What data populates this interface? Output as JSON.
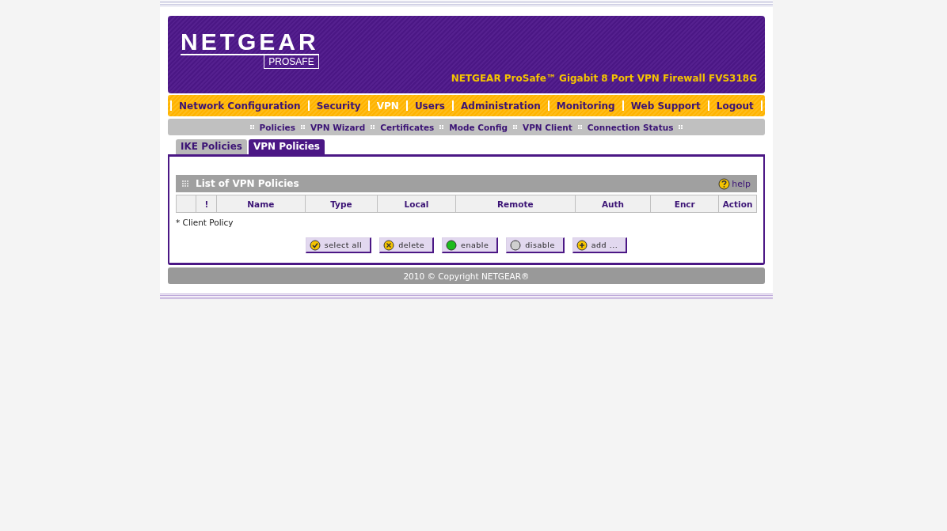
{
  "header": {
    "logo": "NETGEAR",
    "logo_sub": "PROSAFE",
    "product": "NETGEAR ProSafe™ Gigabit 8 Port VPN Firewall FVS318G"
  },
  "nav": [
    {
      "label": "Network Configuration",
      "selected": false
    },
    {
      "label": "Security",
      "selected": false
    },
    {
      "label": "VPN",
      "selected": true
    },
    {
      "label": "Users",
      "selected": false
    },
    {
      "label": "Administration",
      "selected": false
    },
    {
      "label": "Monitoring",
      "selected": false
    },
    {
      "label": "Web Support",
      "selected": false
    },
    {
      "label": "Logout",
      "selected": false
    }
  ],
  "subnav": [
    "Policies",
    "VPN Wizard",
    "Certificates",
    "Mode Config",
    "VPN Client",
    "Connection Status"
  ],
  "tabs": [
    {
      "label": "IKE Policies",
      "selected": false
    },
    {
      "label": "VPN Policies",
      "selected": true
    }
  ],
  "section": {
    "title": "List of VPN Policies",
    "help": "help"
  },
  "table": {
    "columns": [
      "",
      "!",
      "Name",
      "Type",
      "Local",
      "Remote",
      "Auth",
      "Encr",
      "Action"
    ]
  },
  "note": "* Client Policy",
  "buttons": [
    {
      "label": "select all",
      "kind": "check"
    },
    {
      "label": "delete",
      "kind": "cross"
    },
    {
      "label": "enable",
      "kind": "green"
    },
    {
      "label": "disable",
      "kind": "grey"
    },
    {
      "label": "add ...",
      "kind": "plus"
    }
  ],
  "footer": "2010 © Copyright NETGEAR®"
}
